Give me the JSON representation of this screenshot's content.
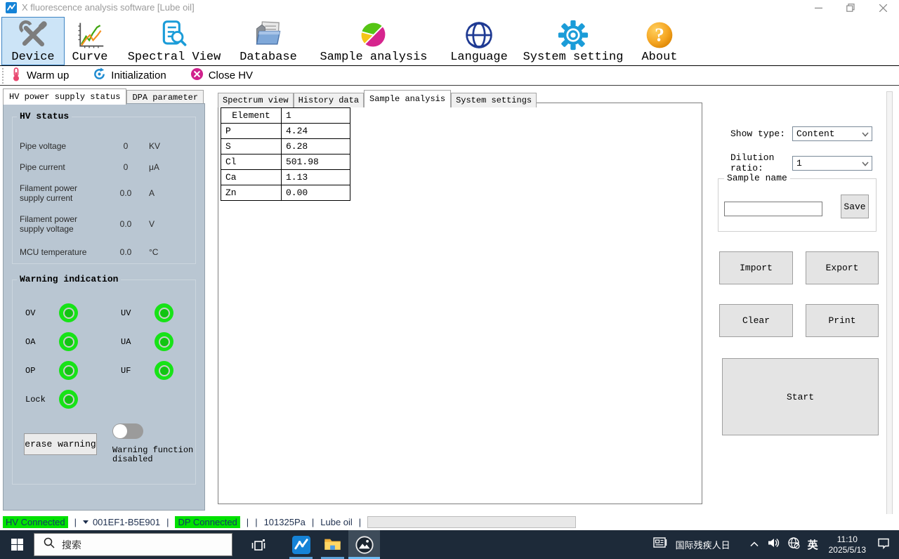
{
  "icons": {
    "about_glyph": "?"
  },
  "titlebar": {
    "title": "X fluorescence analysis software [Lube oil]"
  },
  "toolbar": {
    "items": [
      {
        "label": "Device"
      },
      {
        "label": "Curve"
      },
      {
        "label": "Spectral View"
      },
      {
        "label": "Database"
      },
      {
        "label": "Sample analysis"
      },
      {
        "label": "Language"
      },
      {
        "label": "System setting"
      },
      {
        "label": "About"
      }
    ]
  },
  "actionbar": {
    "warm_up": "Warm up",
    "initialization": "Initialization",
    "close_hv": "Close HV"
  },
  "left_panel": {
    "tabs": [
      {
        "label": "HV power supply status"
      },
      {
        "label": "DPA parameter"
      }
    ],
    "hv_status": {
      "title": "HV status",
      "rows": [
        {
          "label": "Pipe voltage",
          "value": "0",
          "unit": "KV"
        },
        {
          "label": "Pipe current",
          "value": "0",
          "unit": "μA"
        },
        {
          "label": "Filament power supply current",
          "value": "0.0",
          "unit": "A"
        },
        {
          "label": "Filament power supply voltage",
          "value": "0.0",
          "unit": "V"
        },
        {
          "label": "MCU temperature",
          "value": "0.0",
          "unit": "°C"
        }
      ]
    },
    "warning": {
      "title": "Warning indication",
      "left": [
        {
          "label": "OV"
        },
        {
          "label": "OA"
        },
        {
          "label": "OP"
        },
        {
          "label": "Lock"
        }
      ],
      "right": [
        {
          "label": "UV"
        },
        {
          "label": "UA"
        },
        {
          "label": "UF"
        }
      ],
      "erase_button": "erase warning",
      "toggle_caption": "Warning function disabled"
    }
  },
  "main": {
    "tabs": [
      {
        "label": "Spectrum view"
      },
      {
        "label": "History data"
      },
      {
        "label": "Sample analysis"
      },
      {
        "label": "System settings"
      }
    ],
    "table": {
      "headers": [
        "Element",
        "1"
      ],
      "rows": [
        [
          "P",
          "4.24"
        ],
        [
          "S",
          "6.28"
        ],
        [
          "Cl",
          "501.98"
        ],
        [
          "Ca",
          "1.13"
        ],
        [
          "Zn",
          "0.00"
        ]
      ]
    }
  },
  "right_panel": {
    "show_type_label": "Show type:",
    "show_type_value": "Content",
    "dilution_label": "Dilution ratio:",
    "dilution_value": "1",
    "sample_name_title": "Sample name",
    "save_label": "Save",
    "import_label": "Import",
    "export_label": "Export",
    "clear_label": "Clear",
    "print_label": "Print",
    "start_label": "Start"
  },
  "status_bar": {
    "sep": "|",
    "hv_badge": "HV Connected",
    "device_id": "001EF1-B5E901",
    "dp_badge": "DP Connected",
    "pressure": "101325Pa",
    "sample": "Lube oil",
    "badge_color": "#00e100"
  },
  "taskbar": {
    "search_placeholder": "搜索",
    "tray_text": "国际残疾人日",
    "lang": "英",
    "time": "11:10",
    "date": "2025/5/13"
  }
}
